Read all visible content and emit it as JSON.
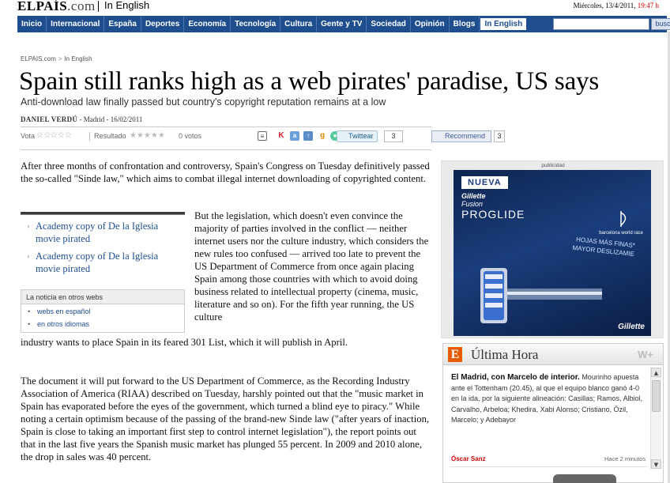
{
  "header": {
    "logo_main": "ELPAÍS",
    "logo_suffix": ".com",
    "section": "In English",
    "date": "Miércoles, 13/4/2011,",
    "time": "19:47 h"
  },
  "nav": {
    "items": [
      "Inicio",
      "Internacional",
      "España",
      "Deportes",
      "Economía",
      "Tecnología",
      "Cultura",
      "Gente y TV",
      "Sociedad",
      "Opinión",
      "Blogs",
      "In English"
    ],
    "active": "In English",
    "search_value": "",
    "search_button": "buscar"
  },
  "breadcrumb": {
    "home": "ELPAIS.com",
    "sep": ">",
    "current": "In English"
  },
  "article": {
    "headline": "Spain still ranks high as a web pirates' paradise, US says",
    "subheadline": "Anti-download law finally passed but country's copyright reputation remains at a low",
    "author": "DANIEL VERDÚ",
    "place_date": " - Madrid - 16/02/2011",
    "para1": "After three months of confrontation and controversy, Spain's Congress on Tuesday definitively passed the so-called \"Sinde law,\" which aims to combat illegal internet downloading of copyrighted content.",
    "para2a": "But the legislation, which doesn't even convince the majority of parties involved in the conflict — neither internet users nor the culture industry, which considers the new rules too confused — arrived too late to prevent the US Department of Commerce from once again placing Spain among those countries with which to avoid doing business related to intellectual property (cinema, music, literature and so on). For the fifth year running, the US culture",
    "para2b": "industry wants to place Spain in its feared 301 List, which it will publish in April.",
    "para3": "The document it will put forward to the US Department of Commerce, as the Recording Industry Association of America (RIAA) described on Tuesday, harshly pointed out that the \"music market in Spain has evaporated before the eyes of the government, which turned a blind eye to piracy.\" While noting a certain optimism because of the passing of the brand-new Sinde law (\"after years of inaction, Spain is close to taking an important first step to control internet legislation\"), the report points out that in the last five years the Spanish music market has plunged 55 percent. In 2009 and 2010 alone, the drop in sales was 40 percent."
  },
  "tools": {
    "vota_label": "Vota",
    "resultado_label": "Resultado",
    "votes": "0 votos",
    "twitter_label": "Twittear",
    "twitter_count": "3",
    "fb_label": "Recommend",
    "fb_count": "3"
  },
  "related": {
    "items": [
      "Academy copy of De la Iglesia movie pirated",
      "Academy copy of De la Iglesia movie pirated"
    ],
    "otros_title": "La noticia en otros webs",
    "otros_items": [
      "webs en español",
      "en otros idiomas"
    ]
  },
  "ad": {
    "label": "publicidad",
    "nueva": "NUEVA",
    "brand": "Gillette",
    "fusion": "Fusion",
    "proglide": "PROGLIDE",
    "race": "barcelona world race",
    "hojas": "HOJAS MÁS FINAS*",
    "mayor": "MAYOR DESLIZAMIE",
    "gillette": "Gillette"
  },
  "ultima_hora": {
    "logo": "E",
    "title": "Última Hora",
    "w": "W+",
    "headline": "El Madrid, con Marcelo de interior.",
    "text": " Mourinho apuesta ante el Tottenham (20.45), al que el equipo blanco ganó 4-0 en la ida, por la siguiente alineación: Casillas; Ramos, Albiol, Carvalho, Arbeloa; Khedira, Xabi Alonso; Cristiano, Özil, Marcelo; y Adebayor",
    "author": "Óscar Sanz",
    "ago": "Hace 2 minutos"
  }
}
